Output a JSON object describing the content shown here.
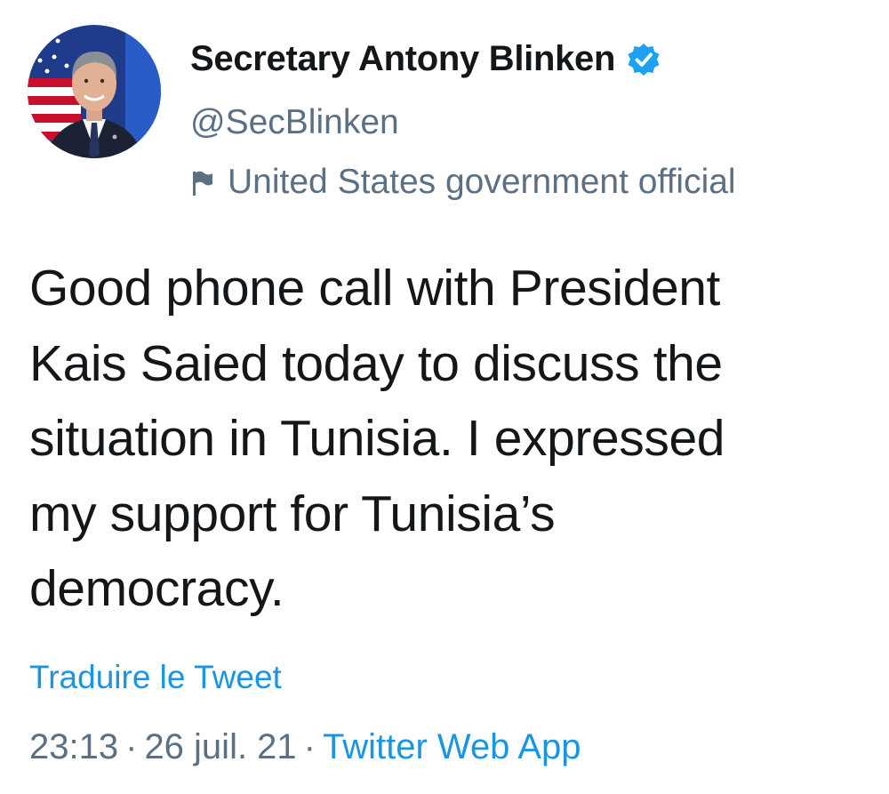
{
  "author": {
    "display_name": "Secretary Antony Blinken",
    "handle": "@SecBlinken",
    "label": "United States government official",
    "verified_icon": "verified-badge-icon",
    "label_icon": "flag-icon",
    "colors": {
      "verified": "#1da1f2",
      "secondary_text": "#5b7083"
    }
  },
  "tweet": {
    "text_lines": [
      "Good phone call with President",
      "Kais Saied today to discuss the",
      "situation in Tunisia. I expressed",
      "my support for Tunisia’s",
      "democracy."
    ],
    "translate_label": "Traduire le Tweet",
    "time": "23:13",
    "date": "26 juil. 21",
    "separator": "·",
    "source": "Twitter Web App",
    "colors": {
      "link": "#1b95e0"
    }
  }
}
